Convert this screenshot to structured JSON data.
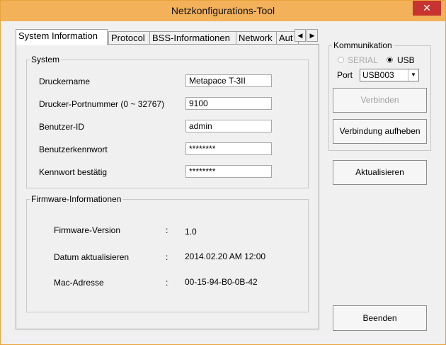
{
  "window": {
    "title": "Netzkonfigurations-Tool",
    "close_glyph": "✕"
  },
  "tabs": [
    {
      "label": "System Information",
      "active": true
    },
    {
      "label": "Protocol"
    },
    {
      "label": "BSS-Informationen"
    },
    {
      "label": "Network"
    },
    {
      "label": "Aut"
    }
  ],
  "tab_scroll": {
    "left": "◀",
    "right": "▶"
  },
  "system": {
    "legend": "System",
    "rows": [
      {
        "label": "Druckername",
        "value": "Metapace T-3II"
      },
      {
        "label": "Drucker-Portnummer (0 ~ 32767)",
        "value": "9100"
      },
      {
        "label": "Benutzer-ID",
        "value": "admin"
      },
      {
        "label": "Benutzerkennwort",
        "value": "********"
      },
      {
        "label": "Kennwort bestätig",
        "value": "********"
      }
    ]
  },
  "firmware": {
    "legend": "Firmware-Informationen",
    "rows": [
      {
        "label": "Firmware-Version",
        "sep": ":",
        "value": "1.0"
      },
      {
        "label": "Datum aktualisieren",
        "sep": ":",
        "value": "2014.02.20 AM 12:00"
      },
      {
        "label": "Mac-Adresse",
        "sep": ":",
        "value": "00-15-94-B0-0B-42"
      }
    ]
  },
  "communication": {
    "legend": "Kommunikation",
    "serial_label": "SERIAL",
    "usb_label": "USB",
    "selected": "USB",
    "port_label": "Port",
    "port_value": "USB003",
    "connect_label": "Verbinden",
    "disconnect_label": "Verbindung aufheben"
  },
  "refresh_label": "Aktualisieren",
  "exit_label": "Beenden"
}
